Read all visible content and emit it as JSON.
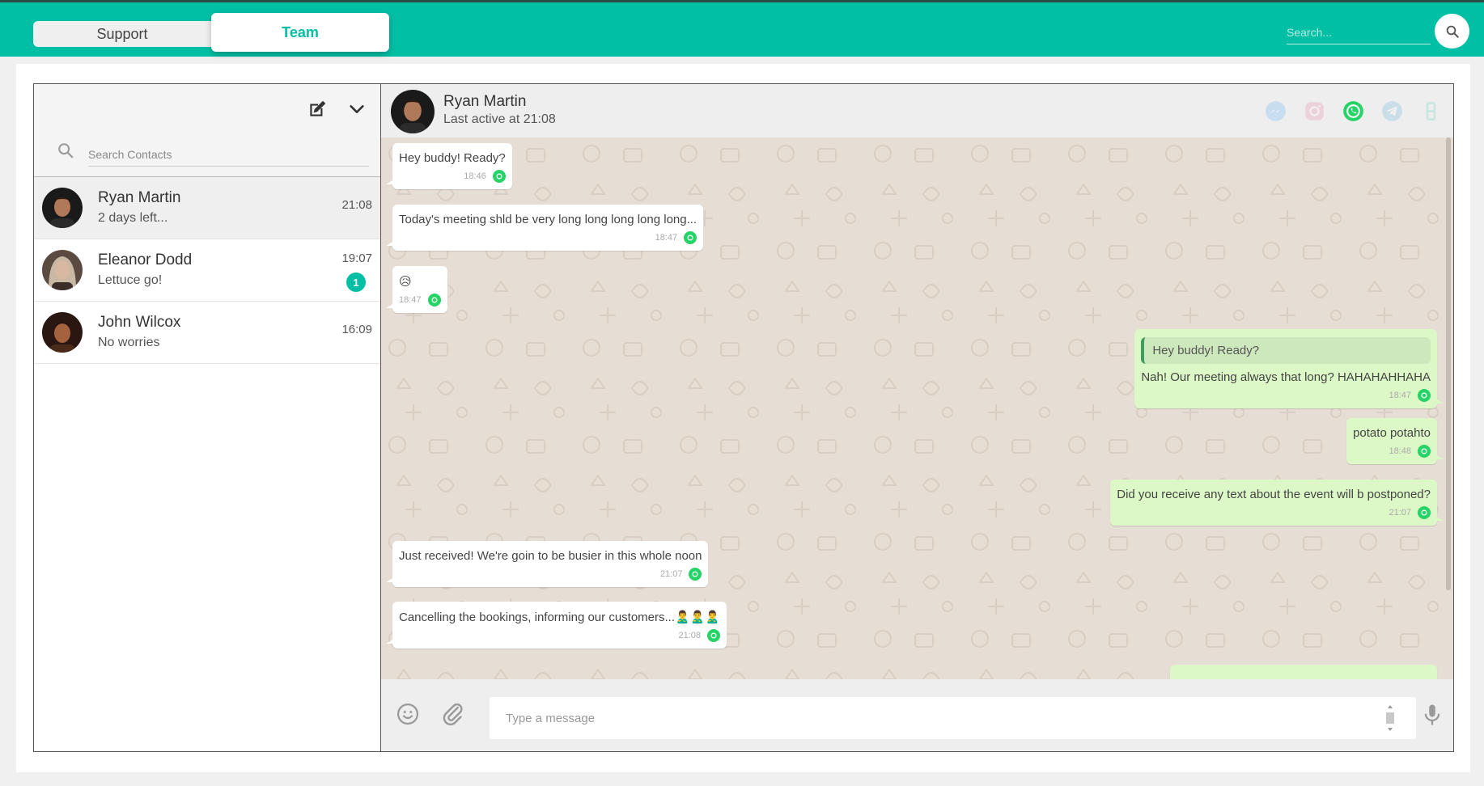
{
  "tabs": [
    {
      "label": "Support",
      "active": false
    },
    {
      "label": "Team",
      "active": true
    }
  ],
  "top_search": {
    "placeholder": "Search..."
  },
  "sidebar": {
    "search_placeholder": "Search Contacts",
    "contacts": [
      {
        "name": "Ryan Martin",
        "last_message": "2 days left...",
        "time": "21:08",
        "active": true
      },
      {
        "name": "Eleanor Dodd",
        "last_message": "Lettuce go!",
        "time": "19:07",
        "unread": "1"
      },
      {
        "name": "John Wilcox",
        "last_message": "No worries",
        "time": "16:09"
      }
    ]
  },
  "chat": {
    "contact_name": "Ryan Martin",
    "status": "Last active at 21:08",
    "channels": [
      "messenger-icon",
      "instagram-icon",
      "whatsapp-icon",
      "telegram-icon",
      "viber-icon"
    ],
    "active_channel": "whatsapp-icon",
    "messages": [
      {
        "dir": "in",
        "text": "Hey buddy! Ready?",
        "time": "18:46"
      },
      {
        "dir": "in",
        "text": "Today's meeting shld be very long long long long long...",
        "time": "18:47"
      },
      {
        "dir": "in",
        "text": "😥",
        "time": "18:47"
      },
      {
        "dir": "out",
        "quote": "Hey buddy! Ready?",
        "text": "Nah! Our meeting always that long? HAHAHAHHAHA",
        "time": "18:47"
      },
      {
        "dir": "out",
        "text": "potato potahto",
        "time": "18:48"
      },
      {
        "dir": "out",
        "text": "Did you receive any text about the event will b postponed?",
        "time": "21:07"
      },
      {
        "dir": "in",
        "text": "Just received! We're goin to be busier in this whole noon",
        "time": "21:07"
      },
      {
        "dir": "in",
        "text": "Cancelling the bookings, informing our customers...🙎‍♂️🙎‍♂️🙎‍♂️",
        "time": "21:08"
      }
    ],
    "composer_placeholder": "Type a message"
  },
  "colors": {
    "brand": "#00bfa5",
    "whatsapp": "#25d366",
    "incoming_bubble": "#ffffff",
    "outgoing_bubble": "#dcf8c6",
    "chat_background": "#e6ddd4"
  }
}
